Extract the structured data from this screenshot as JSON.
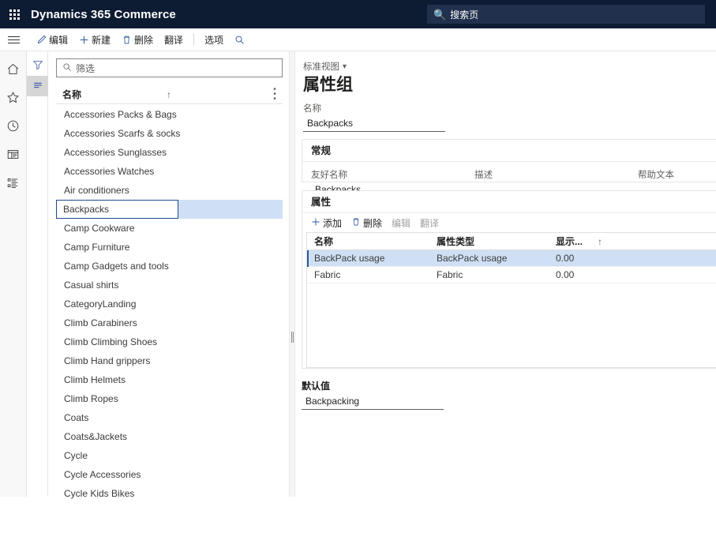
{
  "topnav": {
    "app_title": "Dynamics 365 Commerce",
    "waffle_icon": "app-launcher-icon",
    "search": {
      "icon": "search-icon",
      "placeholder": "搜索页",
      "value": ""
    }
  },
  "commandbar": {
    "hamburger_icon": "hamburger-menu-icon",
    "buttons": [
      {
        "label": "编辑",
        "icon": "pencil-icon"
      },
      {
        "label": "新建",
        "icon": "plus-icon"
      },
      {
        "label": "删除",
        "icon": "trash-icon"
      },
      {
        "label": "翻译",
        "icon": ""
      },
      {
        "label": "选项",
        "icon": ""
      }
    ],
    "search_icon": "search-icon"
  },
  "rail": {
    "items": [
      {
        "name": "home",
        "icon": "home-icon"
      },
      {
        "name": "favorites",
        "icon": "star-icon"
      },
      {
        "name": "recent",
        "icon": "clock-icon"
      },
      {
        "name": "workspaces",
        "icon": "dashboard-icon"
      },
      {
        "name": "modules",
        "icon": "list-icon"
      }
    ]
  },
  "rail2": {
    "items": [
      {
        "name": "filter",
        "icon": "funnel-icon",
        "active": false
      },
      {
        "name": "list-view",
        "icon": "lines-icon",
        "active": true
      }
    ]
  },
  "listpane": {
    "filter": {
      "icon": "search-icon",
      "placeholder": "筛选",
      "value": ""
    },
    "header": {
      "name_label": "名称",
      "sort_icon": "arrow-up-icon",
      "more_icon": "overflow-menu-icon"
    },
    "items": [
      {
        "label": "Accessories Packs & Bags",
        "selected": false
      },
      {
        "label": "Accessories Scarfs & socks",
        "selected": false
      },
      {
        "label": "Accessories Sunglasses",
        "selected": false
      },
      {
        "label": "Accessories Watches",
        "selected": false
      },
      {
        "label": "Air conditioners",
        "selected": false
      },
      {
        "label": "Backpacks",
        "selected": true
      },
      {
        "label": "Camp Cookware",
        "selected": false
      },
      {
        "label": "Camp Furniture",
        "selected": false
      },
      {
        "label": "Camp Gadgets and tools",
        "selected": false
      },
      {
        "label": "Casual shirts",
        "selected": false
      },
      {
        "label": "CategoryLanding",
        "selected": false
      },
      {
        "label": "Climb Carabiners",
        "selected": false
      },
      {
        "label": "Climb Climbing Shoes",
        "selected": false
      },
      {
        "label": "Climb Hand grippers",
        "selected": false
      },
      {
        "label": "Climb Helmets",
        "selected": false
      },
      {
        "label": "Climb Ropes",
        "selected": false
      },
      {
        "label": "Coats",
        "selected": false
      },
      {
        "label": "Coats&Jackets",
        "selected": false
      },
      {
        "label": "Cycle",
        "selected": false
      },
      {
        "label": "Cycle Accessories",
        "selected": false
      },
      {
        "label": "Cycle Kids Bikes",
        "selected": false
      }
    ]
  },
  "detail": {
    "view_selector": {
      "label": "标准视图",
      "chevron_icon": "chevron-down-icon"
    },
    "page_title": "属性组",
    "name_field": {
      "label": "名称",
      "value": "Backpacks"
    },
    "general_section": {
      "title": "常规",
      "fields": [
        {
          "label": "友好名称",
          "value": "Backpacks"
        },
        {
          "label": "描述",
          "value": ""
        },
        {
          "label": "帮助文本",
          "value": ""
        }
      ]
    },
    "attributes_section": {
      "title": "属性",
      "toolbar": [
        {
          "label": "添加",
          "icon": "plus-icon",
          "disabled": false
        },
        {
          "label": "删除",
          "icon": "trash-icon",
          "disabled": false
        },
        {
          "label": "编辑",
          "icon": "",
          "disabled": true
        },
        {
          "label": "翻译",
          "icon": "",
          "disabled": true
        }
      ],
      "columns": [
        "名称",
        "属性类型",
        "显示..."
      ],
      "sort_icon": "arrow-up-icon",
      "rows": [
        {
          "name": "BackPack usage",
          "type": "BackPack usage",
          "display": "0.00",
          "selected": true
        },
        {
          "name": "Fabric",
          "type": "Fabric",
          "display": "0.00",
          "selected": false
        }
      ]
    },
    "default_value_field": {
      "label": "默认值",
      "value": "Backpacking"
    }
  },
  "colors": {
    "nav_bg": "#0d1b33",
    "nav_search_bg": "#20304d",
    "accent": "#2b579a",
    "selection_bg": "#cfe0f5",
    "selection_border": "#1a4b8c"
  }
}
